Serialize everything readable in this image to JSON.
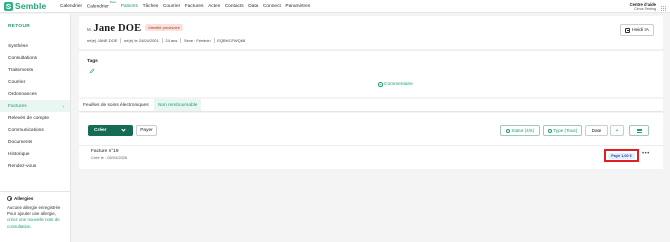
{
  "app": {
    "brand": "Semble",
    "brand_color": "#2db38a",
    "menu": [
      {
        "label": "Calendrier",
        "badge": ""
      },
      {
        "label": "Calendrier",
        "badge": "Beta"
      },
      {
        "label": "Patients",
        "badge": "",
        "active": true
      },
      {
        "label": "Tâches",
        "badge": ""
      },
      {
        "label": "Courrier",
        "badge": ""
      },
      {
        "label": "Factures",
        "badge": ""
      },
      {
        "label": "Actes",
        "badge": ""
      },
      {
        "label": "Contacts",
        "badge": ""
      },
      {
        "label": "Data",
        "badge": ""
      },
      {
        "label": "Connect",
        "badge": ""
      },
      {
        "label": "Paramètres",
        "badge": ""
      }
    ],
    "account": {
      "line1": "Centre d'aide",
      "line2": "Cirrus Testing"
    }
  },
  "sidebar": {
    "back": "RETOUR",
    "items": [
      {
        "label": "Synthèse"
      },
      {
        "label": "Consultations"
      },
      {
        "label": "Traitements"
      },
      {
        "label": "Courrier"
      },
      {
        "label": "Ordonnances"
      },
      {
        "label": "Factures",
        "active": true,
        "chevron": "›"
      },
      {
        "label": "Relevés de compte"
      },
      {
        "label": "Communications"
      },
      {
        "label": "Documents"
      },
      {
        "label": "Historique"
      },
      {
        "label": "Rendez-vous"
      }
    ],
    "allergy": {
      "title": "Allergies",
      "none": "Aucune allergie enregistrée",
      "add_prefix": "Pour ajouter une allergie,",
      "add_link": "créez une nouvelle note de consultation."
    }
  },
  "patient": {
    "prefix": "M. ",
    "name": "Jane DOE",
    "status_badge": "Identité provisoire",
    "meta": [
      "né(e) JANE DOE",
      "né(e) le 24/04/2001",
      "24 ans",
      "Sexe : Féminin",
      "EQBHCFWQ68"
    ],
    "heidi_label": "Heidi IA"
  },
  "tags": {
    "label": "Tags",
    "comment_label": "Commentaire"
  },
  "tabs": [
    {
      "label": "Feuilles de soins électroniques"
    },
    {
      "label": "Non remboursable",
      "active": true
    }
  ],
  "toolbar": {
    "create": "Créer",
    "pay": "Payer",
    "status_filter": "Statut (4/5)",
    "type_filter": "Type (Tous)",
    "date_filter": "Date",
    "plus": "+"
  },
  "invoice": {
    "title": "Facture n°19",
    "created": "Créé le : 05/03/2026",
    "status": "Payé 1,00 €",
    "more": "•••"
  }
}
